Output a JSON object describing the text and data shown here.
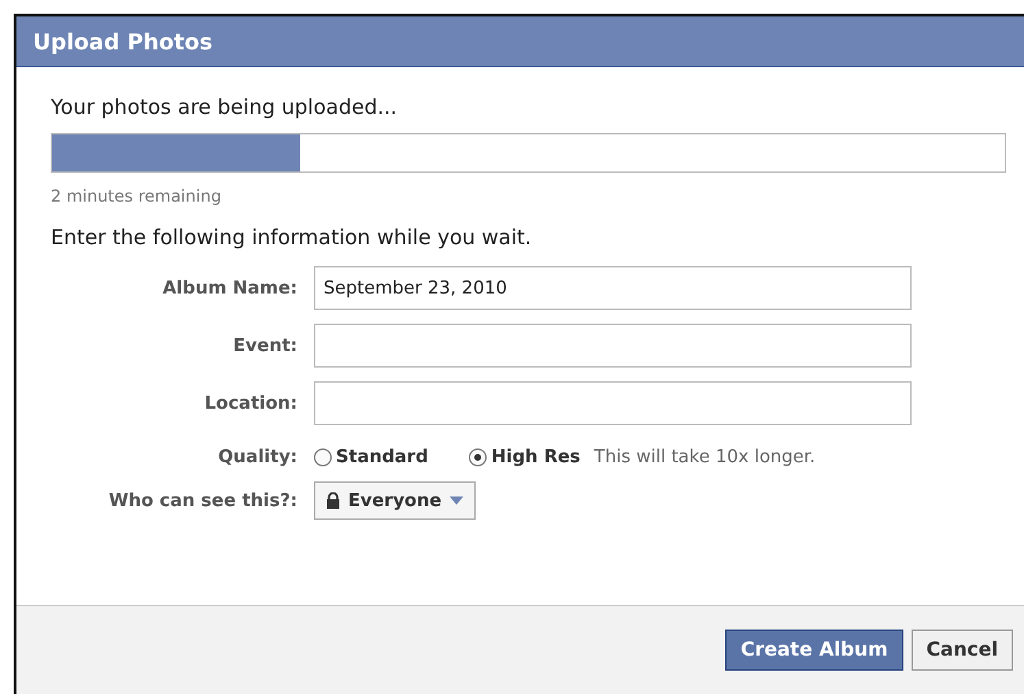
{
  "dialog": {
    "title": "Upload Photos"
  },
  "progress": {
    "heading": "Your photos are being uploaded...",
    "level": 0.26,
    "remaining": "2 minutes remaining"
  },
  "form": {
    "intro": "Enter the following information while you wait.",
    "fields": [
      {
        "label": "Album Name:",
        "value": "September 23, 2010"
      },
      {
        "label": "Event:"
      },
      {
        "label": "Location:"
      }
    ],
    "quality": {
      "label": "Quality:",
      "options": [
        {
          "label": "Standard",
          "selected": false
        },
        {
          "label": "High Res",
          "selected": true
        }
      ],
      "note": "This will take 10x longer."
    },
    "privacy": {
      "label": "Who can see this?:",
      "value": "Everyone"
    }
  },
  "buttons": [
    {
      "label": "Create Album",
      "kind": "primary"
    },
    {
      "label": "Cancel",
      "kind": "secondary"
    }
  ]
}
